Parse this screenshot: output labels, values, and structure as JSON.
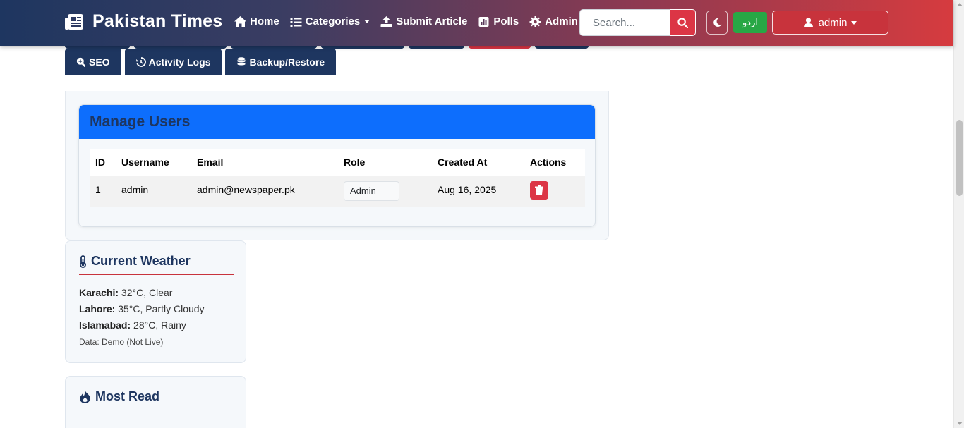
{
  "navbar": {
    "brand": "Pakistan Times",
    "links": [
      {
        "label": "Home",
        "icon": "home-icon"
      },
      {
        "label": "Categories",
        "icon": "list-icon",
        "dropdown": true
      },
      {
        "label": "Submit Article",
        "icon": "upload-icon"
      },
      {
        "label": "Polls",
        "icon": "poll-icon"
      },
      {
        "label": "Admin",
        "icon": "gear-icon"
      }
    ],
    "search_placeholder": "Search...",
    "lang_label": "اردو",
    "user_label": "admin"
  },
  "tabs": [
    {
      "label": "SEO",
      "icon": "search-plus-icon"
    },
    {
      "label": "Activity Logs",
      "icon": "history-icon"
    },
    {
      "label": "Backup/Restore",
      "icon": "database-icon"
    }
  ],
  "manage_users": {
    "title": "Manage Users",
    "columns": [
      "ID",
      "Username",
      "Email",
      "Role",
      "Created At",
      "Actions"
    ],
    "rows": [
      {
        "id": "1",
        "username": "admin",
        "email": "admin@newspaper.pk",
        "role": "Admin",
        "created_at": "Aug 16, 2025"
      }
    ]
  },
  "weather": {
    "title": "Current Weather",
    "entries": [
      {
        "city": "Karachi:",
        "value": "32°C, Clear"
      },
      {
        "city": "Lahore:",
        "value": "35°C, Partly Cloudy"
      },
      {
        "city": "Islamabad:",
        "value": "28°C, Rainy"
      }
    ],
    "note": "Data: Demo (Not Live)"
  },
  "most_read": {
    "title": "Most Read"
  },
  "colors": {
    "navy": "#1e3660",
    "accent_red": "#dc3545",
    "primary_blue": "#0d6efd",
    "success_green": "#28a745"
  }
}
